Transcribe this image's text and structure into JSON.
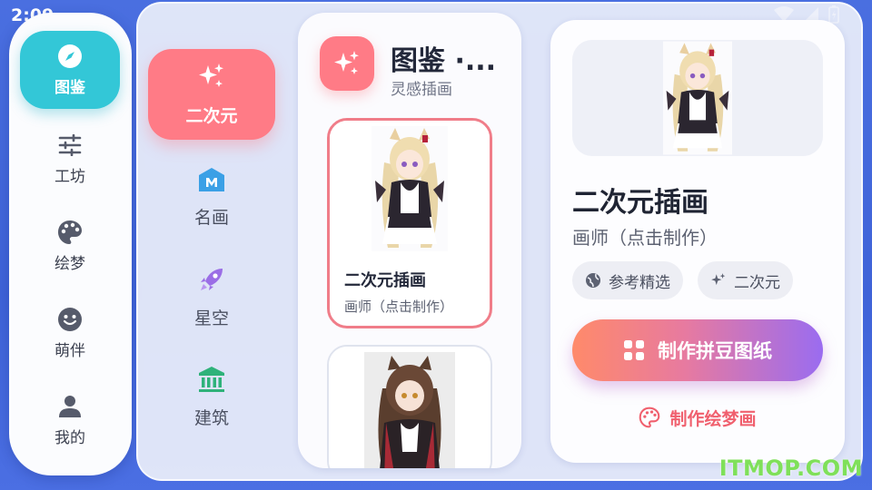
{
  "status_bar": {
    "time": "2:09"
  },
  "nav_rail": {
    "items": [
      {
        "label": "图鉴",
        "icon": "compass-icon",
        "active": true
      },
      {
        "label": "工坊",
        "icon": "sliders-icon",
        "active": false
      },
      {
        "label": "绘梦",
        "icon": "palette-icon",
        "active": false
      },
      {
        "label": "萌伴",
        "icon": "smiley-icon",
        "active": false
      },
      {
        "label": "我的",
        "icon": "person-icon",
        "active": false
      }
    ]
  },
  "categories": [
    {
      "label": "二次元",
      "icon": "sparkles-icon",
      "active": true
    },
    {
      "label": "名画",
      "icon": "museum-icon",
      "active": false
    },
    {
      "label": "星空",
      "icon": "rocket-icon",
      "active": false
    },
    {
      "label": "建筑",
      "icon": "bank-icon",
      "active": false
    }
  ],
  "list": {
    "title": "图鉴 ·...",
    "subtitle": "灵感插画",
    "items": [
      {
        "title": "二次元插画",
        "subtitle": "画师（点击制作）",
        "selected": true
      },
      {
        "title": "",
        "subtitle": "",
        "selected": false
      }
    ]
  },
  "detail": {
    "title": "二次元插画",
    "subtitle": "画师（点击制作）",
    "chips": [
      {
        "label": "参考精选",
        "icon": "globe-icon"
      },
      {
        "label": "二次元",
        "icon": "sparkles-icon"
      }
    ],
    "primary_button": "制作拼豆图纸",
    "secondary_button": "制作绘梦画"
  },
  "watermark": "ITMOP.COM",
  "colors": {
    "rail_active": "#33c7d7",
    "category_active": "#ff7b86",
    "button_gradient_start": "#ff8a6a",
    "button_gradient_end": "#9a6cf0"
  }
}
